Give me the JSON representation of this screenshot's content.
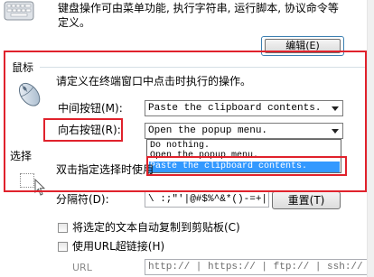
{
  "keyboard": {
    "icon": "keyboard-icon",
    "desc_line1": "键盘操作可由菜单功能, 执行字符串, 运行脚本, 协议命令等",
    "desc_line2": "定义。",
    "edit_button": "编辑(E)"
  },
  "mouse": {
    "group_label": "鼠标",
    "icon": "mouse-icon",
    "description": "请定义在终端窗口中点击时执行的操作。",
    "middle_label": "中间按钮(M):",
    "middle_value": "Paste the clipboard contents.",
    "right_label": "向右按钮(R):",
    "right_value": "Open the popup menu.",
    "dropdown_options": [
      "Do nothing.",
      "Open the popup menu.",
      "Paste the clipboard contents."
    ]
  },
  "selection": {
    "group_label": "选择",
    "description": "双击指定选择时使用",
    "delimiter_label": "分隔符(D):",
    "delimiter_value": "\\ :;\"'|@#$%^&*()-=+|",
    "reset_button": "重置(T)",
    "auto_copy_label": "将选定的文本自动复制到剪贴板(C)",
    "auto_copy_checked": false,
    "url_hyperlink_label": "使用URL超链接(H)",
    "url_hyperlink_checked": false,
    "url_field_label": "URL",
    "url_value": "http:// | https:// | ftp:// | ssh://"
  },
  "colors": {
    "highlight_red": "#e0222c",
    "selection_blue": "#3399ff",
    "focus_ring": "#3c7fb1"
  }
}
